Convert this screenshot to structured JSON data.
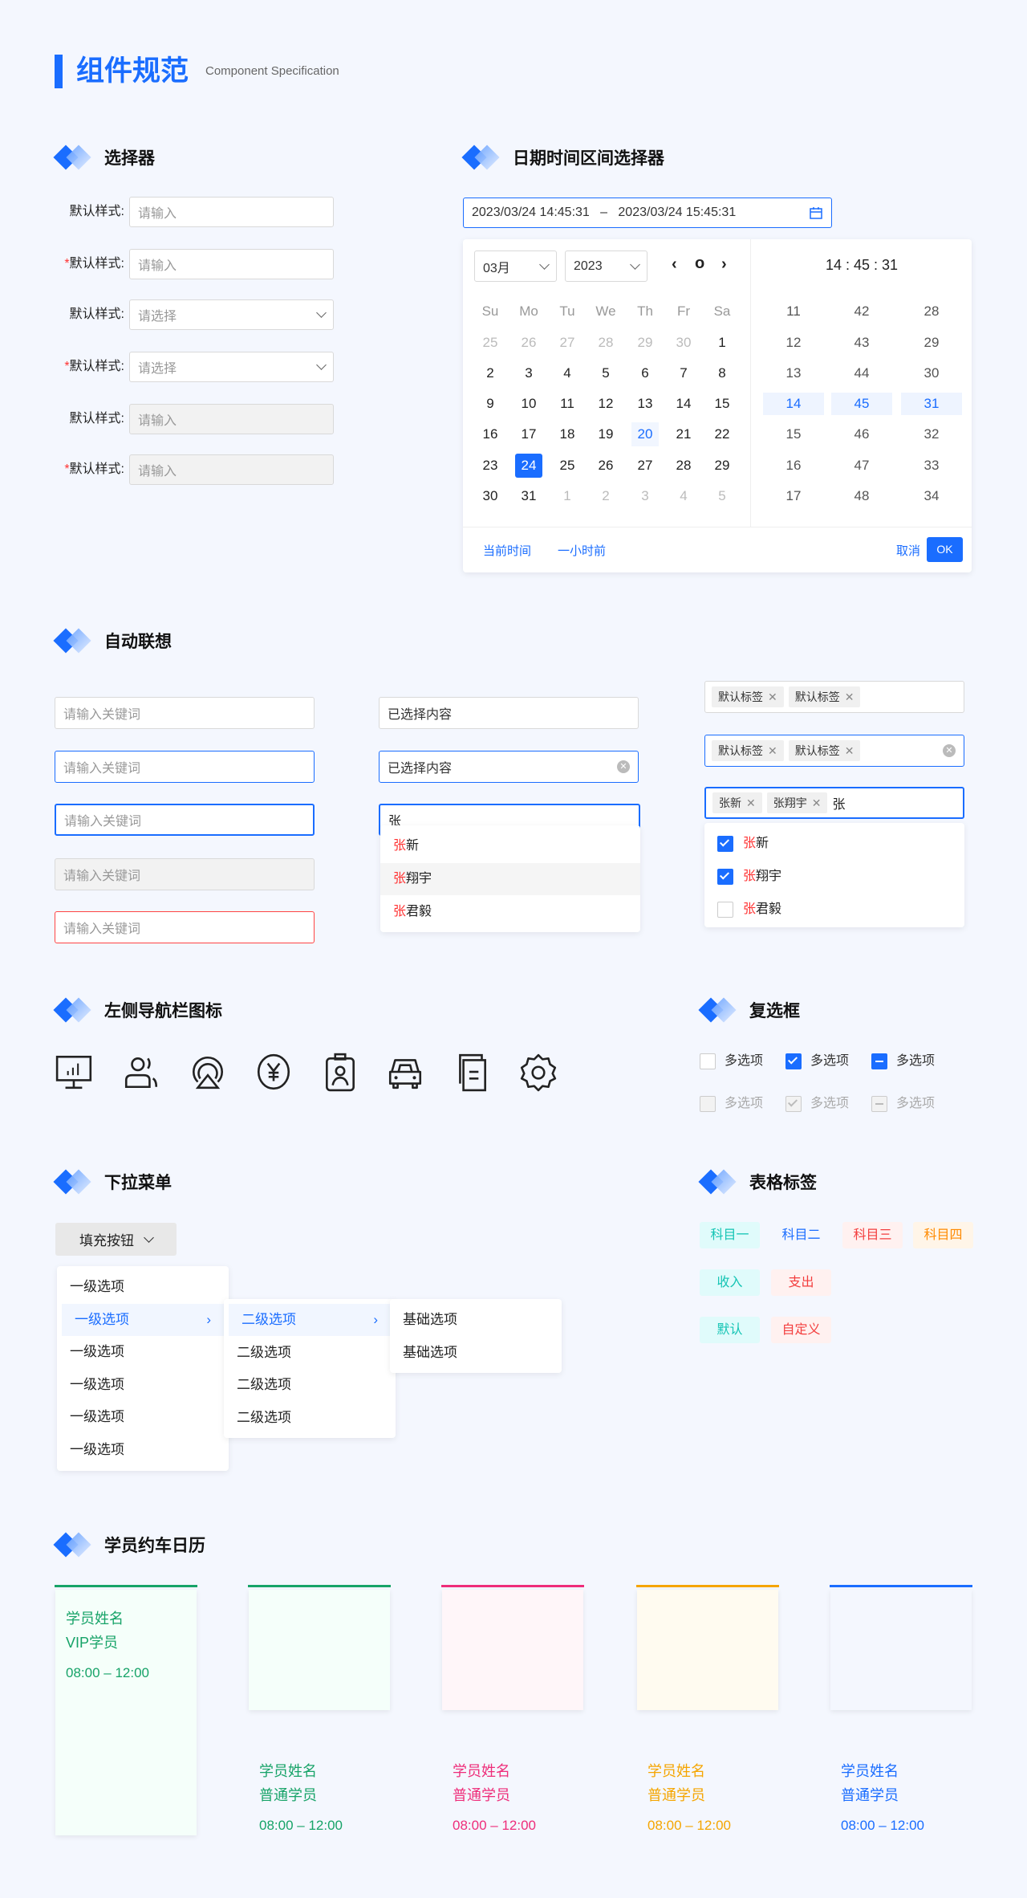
{
  "page": {
    "title": "组件规范",
    "subtitle": "Component Specification"
  },
  "sections": {
    "selector": "选择器",
    "datetime": "日期时间区间选择器",
    "autocomplete": "自动联想",
    "nav_icons": "左侧导航栏图标",
    "checkbox": "复选框",
    "dropdown": "下拉菜单",
    "table_tags": "表格标签",
    "calendar": "学员约车日历"
  },
  "selector_rows": [
    {
      "label": "默认样式:",
      "required": false,
      "placeholder": "请输入",
      "type": "input"
    },
    {
      "label": "默认样式:",
      "required": true,
      "placeholder": "请输入",
      "type": "input"
    },
    {
      "label": "默认样式:",
      "required": false,
      "placeholder": "请选择",
      "type": "select"
    },
    {
      "label": "默认样式:",
      "required": true,
      "placeholder": "请选择",
      "type": "select"
    },
    {
      "label": "默认样式:",
      "required": false,
      "placeholder": "请输入",
      "type": "disabled"
    },
    {
      "label": "默认样式:",
      "required": true,
      "placeholder": "请输入",
      "type": "disabled"
    }
  ],
  "required_mark": "*",
  "datetime": {
    "start": "2023/03/24 14:45:31",
    "sep": "–",
    "end": "2023/03/24 15:45:31",
    "month": "03月",
    "year": "2023",
    "prev": "‹",
    "today": "o",
    "next": "›",
    "weekdays": [
      "Su",
      "Mo",
      "Tu",
      "We",
      "Th",
      "Fr",
      "Sa"
    ],
    "days": [
      [
        "25",
        "26",
        "27",
        "28",
        "29",
        "30",
        "1"
      ],
      [
        "2",
        "3",
        "4",
        "5",
        "6",
        "7",
        "8"
      ],
      [
        "9",
        "10",
        "11",
        "12",
        "13",
        "14",
        "15"
      ],
      [
        "16",
        "17",
        "18",
        "19",
        "20",
        "21",
        "22"
      ],
      [
        "23",
        "24",
        "25",
        "26",
        "27",
        "28",
        "29"
      ],
      [
        "30",
        "31",
        "1",
        "2",
        "3",
        "4",
        "5"
      ]
    ],
    "today_day": "20",
    "selected_day": "24",
    "time_display": "14 : 45 : 31",
    "hours": [
      "11",
      "12",
      "13",
      "14",
      "15",
      "16",
      "17"
    ],
    "minutes": [
      "42",
      "43",
      "44",
      "45",
      "46",
      "47",
      "48"
    ],
    "seconds": [
      "28",
      "29",
      "30",
      "31",
      "32",
      "33",
      "34"
    ],
    "selected_index": 3,
    "now": "当前时间",
    "hour_ago": "一小时前",
    "cancel": "取消",
    "ok": "OK"
  },
  "autocomplete": {
    "placeholder": "请输入关键词",
    "selected_value": "已选择内容",
    "typed": "张",
    "tags": [
      "默认标签",
      "默认标签"
    ],
    "typed_tags": [
      "张新",
      "张翔宇"
    ],
    "options": [
      {
        "hl": "张",
        "rest": "新",
        "checked": true
      },
      {
        "hl": "张",
        "rest": "翔宇",
        "checked": true
      },
      {
        "hl": "张",
        "rest": "君毅",
        "checked": false
      }
    ]
  },
  "nav_icons": [
    "monitor-chart-icon",
    "users-icon",
    "location-icon",
    "yuan-icon",
    "badge-icon",
    "car-icon",
    "documents-icon",
    "settings-icon"
  ],
  "checkbox": {
    "label": "多选项"
  },
  "dropdown": {
    "button": "填充按钮",
    "level1": [
      "一级选项",
      "一级选项",
      "一级选项",
      "一级选项",
      "一级选项",
      "一级选项"
    ],
    "level2": [
      "二级选项",
      "二级选项",
      "二级选项",
      "二级选项"
    ],
    "level3": [
      "基础选项",
      "基础选项"
    ]
  },
  "tags": [
    {
      "text": "科目一",
      "color": "#14c4b4",
      "bg": "#e0fbfb"
    },
    {
      "text": "科目二",
      "color": "#1a6dff",
      "bg": "#f4f7fe"
    },
    {
      "text": "科目三",
      "color": "#f33d3d",
      "bg": "#fff1f0"
    },
    {
      "text": "科目四",
      "color": "#ff8a00",
      "bg": "#fff5e8"
    },
    {
      "text": "收入",
      "color": "#14c4b4",
      "bg": "#e0fbfb"
    },
    {
      "text": "支出",
      "color": "#f33d3d",
      "bg": "#fff1f0"
    },
    {
      "text": "默认",
      "color": "#14c4b4",
      "bg": "#e0fbfb"
    },
    {
      "text": "自定义",
      "color": "#f33d3d",
      "bg": "#fff1f0"
    }
  ],
  "calendar_cards": [
    {
      "name": "学员姓名",
      "type": "VIP学员",
      "time": "08:00 – 12:00",
      "color": "#17a368",
      "bg": "#f5fffa"
    },
    {
      "name": "学员姓名",
      "type": "普通学员",
      "time": "08:00 – 12:00",
      "color": "#17a368",
      "bg": "#f5fffa"
    },
    {
      "name": "学员姓名",
      "type": "普通学员",
      "time": "08:00 – 12:00",
      "color": "#ee2d7a",
      "bg": "#fff6f9"
    },
    {
      "name": "学员姓名",
      "type": "普通学员",
      "time": "08:00 – 12:00",
      "color": "#f5a500",
      "bg": "#fffbf0"
    },
    {
      "name": "学员姓名",
      "type": "普通学员",
      "time": "08:00 – 12:00",
      "color": "#1a6dff",
      "bg": "#f4f7fe"
    }
  ],
  "colors": {
    "primary": "#1a6dff",
    "error": "#ff4444"
  }
}
